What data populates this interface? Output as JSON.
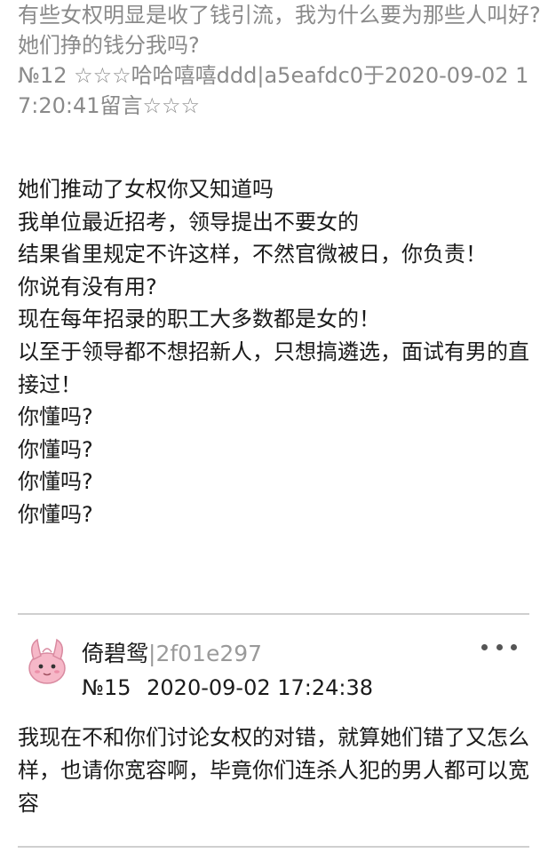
{
  "quote": {
    "text": "有些女权明显是收了钱引流，我为什么要为那些人叫好?她们挣的钱分我吗?",
    "meta": "№12 ☆☆☆哈哈嘻嘻ddd|a5eafdc0于2020-09-02 17:20:41留言☆☆☆"
  },
  "reply": {
    "lines": [
      "她们推动了女权你又知道吗",
      "我单位最近招考，领导提出不要女的",
      "结果省里规定不许这样，不然官微被日，你负责！",
      "你说有没有用?",
      "现在每年招录的职工大多数都是女的！",
      "以至于领导都不想招新人，只想搞遴选，面试有男的直接过！",
      "你懂吗?",
      "你懂吗?",
      "你懂吗?",
      "你懂吗?"
    ]
  },
  "post": {
    "author_name": "倚碧鸳",
    "author_id": "|2f01e297",
    "number": "№15",
    "timestamp": "2020-09-02 17:24:38",
    "body": "我现在不和你们讨论女权的对错，就算她们错了又怎么样，也请你宽容啊，毕竟你们连杀人犯的男人都可以宽容",
    "avatar_icon": "pink-creature-avatar-icon",
    "more_icon": "more-dots-icon"
  }
}
